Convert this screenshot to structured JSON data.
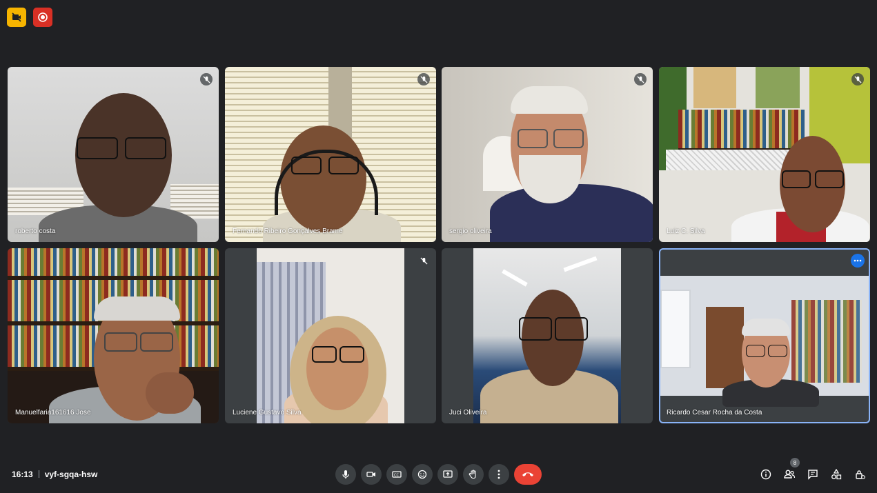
{
  "meeting": {
    "time": "16:13",
    "code": "vyf-sgqa-hsw",
    "participant_count": "8"
  },
  "top_icons": [
    "camera-off-icon",
    "recording-icon"
  ],
  "participants": [
    {
      "name": "roberto costa",
      "muted": true
    },
    {
      "name": "Fernando Ribeiro Gonçalves Brame",
      "muted": true
    },
    {
      "name": "sergio oliveira",
      "muted": true
    },
    {
      "name": "Luiz C. Silva",
      "muted": true
    },
    {
      "name": "Manuelfaria161616 Jose",
      "muted": false
    },
    {
      "name": "Luciene Gustavo Silva",
      "muted": true
    },
    {
      "name": "Juci Oliveira",
      "muted": false
    },
    {
      "name": "Ricardo Cesar Rocha da Costa",
      "muted": false,
      "active": true
    }
  ],
  "controls": [
    "microphone-icon",
    "camera-icon",
    "captions-icon",
    "emoji-icon",
    "present-screen-icon",
    "raise-hand-icon",
    "more-options-icon",
    "end-call-icon"
  ],
  "right_icons": [
    "info-icon",
    "people-icon",
    "chat-icon",
    "activities-icon",
    "host-controls-icon"
  ],
  "colors": {
    "background": "#202124",
    "end_call": "#ea4335",
    "accent": "#8ab4f8"
  }
}
